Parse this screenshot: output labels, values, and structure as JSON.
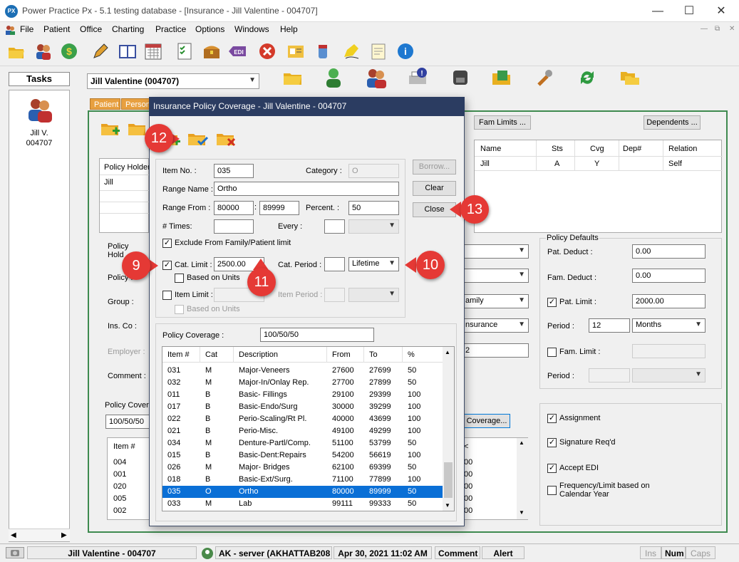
{
  "window": {
    "app_icon": "PX",
    "title": "Power Practice Px  -  5.1 testing database - [Insurance - Jill Valentine - 004707]",
    "controls": [
      "—",
      "☐",
      "✕"
    ]
  },
  "menu": {
    "items": [
      "File",
      "Patient",
      "Office",
      "Charting",
      "Practice",
      "Options",
      "Windows",
      "Help"
    ],
    "mdi_controls": [
      "—",
      "⧉",
      "✕"
    ]
  },
  "toolbar": {
    "icons": [
      "open-folder-icon",
      "patients-icon",
      "exchange-icon",
      "pencil-icon",
      "ledger-icon",
      "calendar-icon",
      "checklist-icon",
      "treasure-chest-icon",
      "edi-icon",
      "stop-icon",
      "id-card-icon",
      "medicine-icon",
      "sign-icon",
      "notepad-icon",
      "help-icon"
    ],
    "edi_label": "EDI"
  },
  "tasks": {
    "header": "Tasks",
    "patient_name": "Jill V.",
    "patient_id": "004707",
    "scroll_left": "◀",
    "scroll_right": "▶"
  },
  "patient_select": {
    "value": "Jill Valentine (004707)"
  },
  "tabs": [
    "Patient",
    "Person"
  ],
  "background": {
    "fam_limits_button": "Fam Limits ...",
    "dependents_button": "Dependents ...",
    "dependents_grid": {
      "headers": [
        "Name",
        "Sts",
        "Cvg",
        "Dep#",
        "Relation"
      ],
      "rows": [
        [
          "Jill",
          "A",
          "Y",
          "",
          "Self"
        ]
      ]
    },
    "policy_holder_label": "Policy Holder",
    "policy_holder_value": "Jill",
    "left_labels": [
      "Policy",
      "Hold",
      "Policy I",
      "Group :",
      "Ins. Co :",
      "Employer :",
      "Comment :"
    ],
    "policy_coverage_label": "Policy Covera",
    "policy_coverage_value": "100/50/50",
    "coverage_button": "Coverage...",
    "partial_values": [
      "amily",
      "nsurance",
      "2"
    ],
    "policy_defaults": {
      "title": "Policy Defaults",
      "pat_deduct_label": "Pat. Deduct :",
      "pat_deduct_value": "0.00",
      "fam_deduct_label": "Fam. Deduct :",
      "fam_deduct_value": "0.00",
      "pat_limit_label": "Pat. Limit :",
      "pat_limit_value": "2000.00",
      "period_label": "Period :",
      "period_value": "12",
      "period_unit": "Months",
      "fam_limit_label": "Fam. Limit :",
      "fam_period_label": "Period :"
    },
    "checkboxes": {
      "assignment": "Assignment",
      "signature": "Signature Req'd",
      "accept_edi": "Accept EDI",
      "frequency_line1": "Frequency/Limit based on",
      "frequency_line2": "Calendar Year"
    },
    "bottom_list": {
      "header": "Item #",
      "items": [
        "004",
        "001",
        "020",
        "005",
        "002"
      ],
      "right_partial": [
        "00",
        "00",
        "00",
        "00",
        "00"
      ],
      "right_header_partial": "<"
    }
  },
  "dialog": {
    "title": "Insurance Policy Coverage - Jill Valentine - 004707",
    "toolbar_icons": [
      "add-folder-icon",
      "confirm-folder-icon",
      "delete-folder-icon"
    ],
    "item_no_label": "Item No. :",
    "item_no_value": "035",
    "category_label": "Category :",
    "category_value": "O",
    "range_name_label": "Range Name :",
    "range_name_value": "Ortho",
    "range_from_label": "Range From :",
    "range_from_value": "80000",
    "range_sep": ":",
    "range_to_value": "89999",
    "percent_label": "Percent. :",
    "percent_value": "50",
    "times_label": "# Times:",
    "every_label": "Every :",
    "exclude_label": "Exclude From Family/Patient limit",
    "cat_limit_label": "Cat. Limit :",
    "cat_limit_value": "2500.00",
    "cat_period_label": "Cat. Period :",
    "cat_period_value": "Lifetime",
    "based_on_units_label": "Based on Units",
    "item_limit_label": "Item Limit :",
    "item_period_label": "Item Period :",
    "based_on_units_label2": "Based on Units",
    "borrow_button": "Borrow...",
    "clear_button": "Clear",
    "close_button": "Close",
    "policy_coverage_label": "Policy Coverage :",
    "policy_coverage_value": "100/50/50",
    "coverage_table": {
      "headers": [
        "Item #",
        "Cat",
        "Description",
        "From",
        "To",
        "%"
      ],
      "rows": [
        [
          "031",
          "M",
          "Major-Veneers",
          "27600",
          "27699",
          "50"
        ],
        [
          "032",
          "M",
          "Major-In/Onlay Rep.",
          "27700",
          "27899",
          "50"
        ],
        [
          "011",
          "B",
          "Basic- Fillings",
          "29100",
          "29399",
          "100"
        ],
        [
          "017",
          "B",
          "Basic-Endo/Surg",
          "30000",
          "39299",
          "100"
        ],
        [
          "022",
          "B",
          "Perio-Scaling/Rt Pl.",
          "40000",
          "43699",
          "100"
        ],
        [
          "021",
          "B",
          "Perio-Misc.",
          "49100",
          "49299",
          "100"
        ],
        [
          "034",
          "M",
          "Denture-Partl/Comp.",
          "51100",
          "53799",
          "50"
        ],
        [
          "015",
          "B",
          "Basic-Dent:Repairs",
          "54200",
          "56619",
          "100"
        ],
        [
          "026",
          "M",
          "Major- Bridges",
          "62100",
          "69399",
          "50"
        ],
        [
          "018",
          "B",
          "Basic-Ext/Surg.",
          "71100",
          "77899",
          "100"
        ],
        [
          "035",
          "O",
          "Ortho",
          "80000",
          "89999",
          "50"
        ],
        [
          "033",
          "M",
          "Lab",
          "99111",
          "99333",
          "50"
        ]
      ],
      "selected_index": 10
    }
  },
  "callouts": [
    "12",
    "13",
    "9",
    "11",
    "10"
  ],
  "status": {
    "patient": "Jill Valentine - 004707",
    "server": "AK - server (AKHATTAB208",
    "datetime": "Apr 30, 2021 11:02 AM",
    "comment": "Comment",
    "alert": "Alert",
    "ins": "Ins",
    "num": "Num",
    "caps": "Caps"
  },
  "colors": {
    "accent": "#0a6fd6",
    "callout": "#e53935",
    "dialog_title": "#2b3c61",
    "frame_green": "#3e8a4f",
    "tab_orange": "#e8a040"
  }
}
